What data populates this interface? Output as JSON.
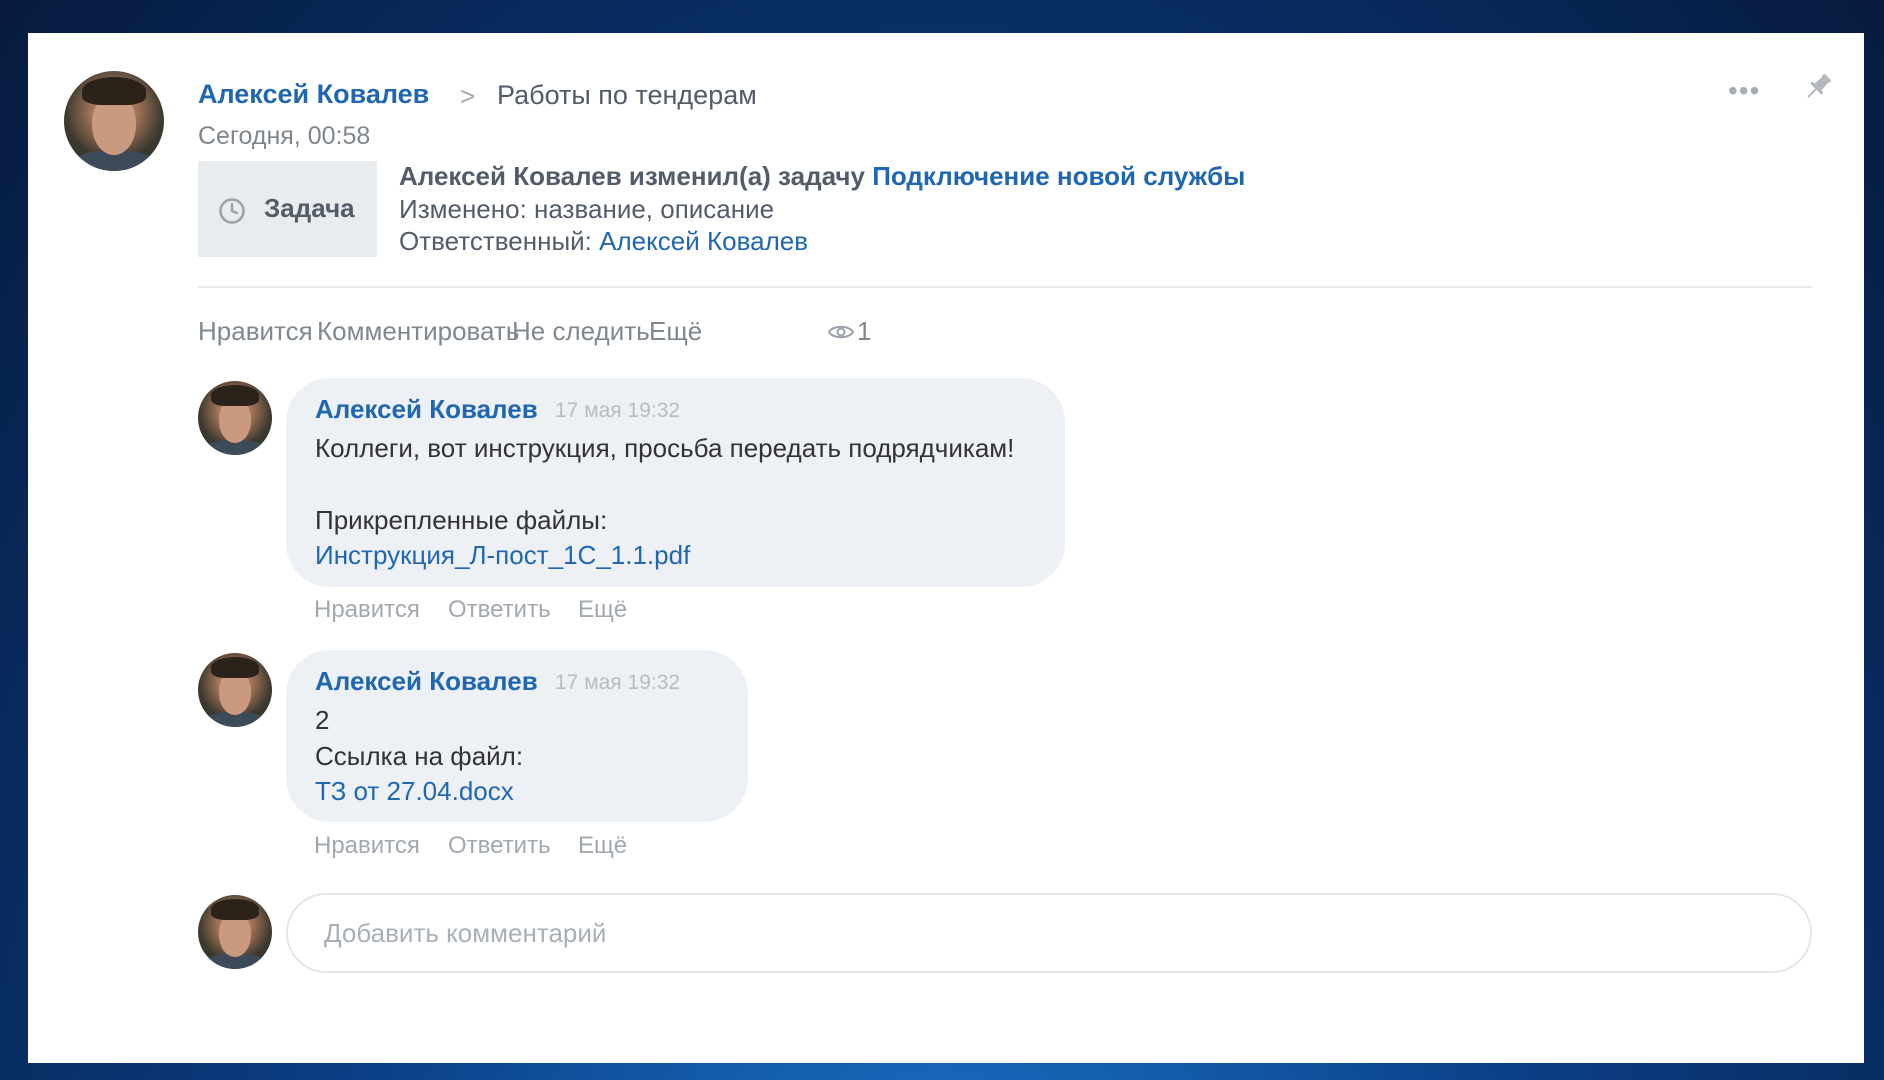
{
  "post": {
    "author": "Алексей Ковалев",
    "breadcrumb_separator": ">",
    "group": "Работы по тендерам",
    "time": "Сегодня, 00:58",
    "task_badge_label": "Задача",
    "task_line1_prefix": "Алексей Ковалев изменил(а) задачу ",
    "task_name": "Подключение новой службы",
    "changed_label": "Изменено: ",
    "changed_value": "название, описание",
    "responsible_label": "Ответственный: ",
    "responsible_value": "Алексей Ковалев",
    "actions": {
      "like": "Нравится",
      "comment": "Комментировать",
      "unfollow": "Не следить",
      "more": "Ещё"
    },
    "views": "1",
    "more_menu": "•••"
  },
  "comments": [
    {
      "author": "Алексей Ковалев",
      "date": "17 мая 19:32",
      "text": "Коллеги, вот инструкция, просьба передать подрядчикам!",
      "files_label": "Прикрепленные файлы:",
      "file": "Инструкция_Л-пост_1С_1.1.pdf",
      "actions": {
        "like": "Нравится",
        "reply": "Ответить",
        "more": "Ещё"
      }
    },
    {
      "author": "Алексей Ковалев",
      "date": "17 мая 19:32",
      "text": "2",
      "link_label": "Ссылка на файл:",
      "file": "ТЗ от 27.04.docx",
      "actions": {
        "like": "Нравится",
        "reply": "Ответить",
        "more": "Ещё"
      }
    }
  ],
  "composer": {
    "placeholder": "Добавить комментарий"
  },
  "colors": {
    "link": "#2067b0",
    "bubble": "#edf0f4",
    "muted_text": "#7f8791"
  },
  "icons": [
    "more-icon",
    "pin-icon",
    "clock-icon",
    "eye-icon"
  ]
}
